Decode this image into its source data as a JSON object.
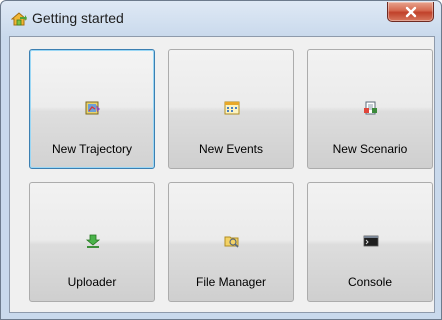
{
  "window": {
    "title": "Getting started",
    "close_glyph": "X"
  },
  "tiles": [
    {
      "label": "New Trajectory",
      "icon": "trajectory-icon"
    },
    {
      "label": "New Events",
      "icon": "events-icon"
    },
    {
      "label": "New Scenario",
      "icon": "scenario-icon"
    },
    {
      "label": "Uploader",
      "icon": "upload-icon"
    },
    {
      "label": "File Manager",
      "icon": "file-manager-icon"
    },
    {
      "label": "Console",
      "icon": "console-icon"
    }
  ],
  "colors": {
    "accent_border": "#3c7fb1",
    "close_red": "#c0412a"
  }
}
